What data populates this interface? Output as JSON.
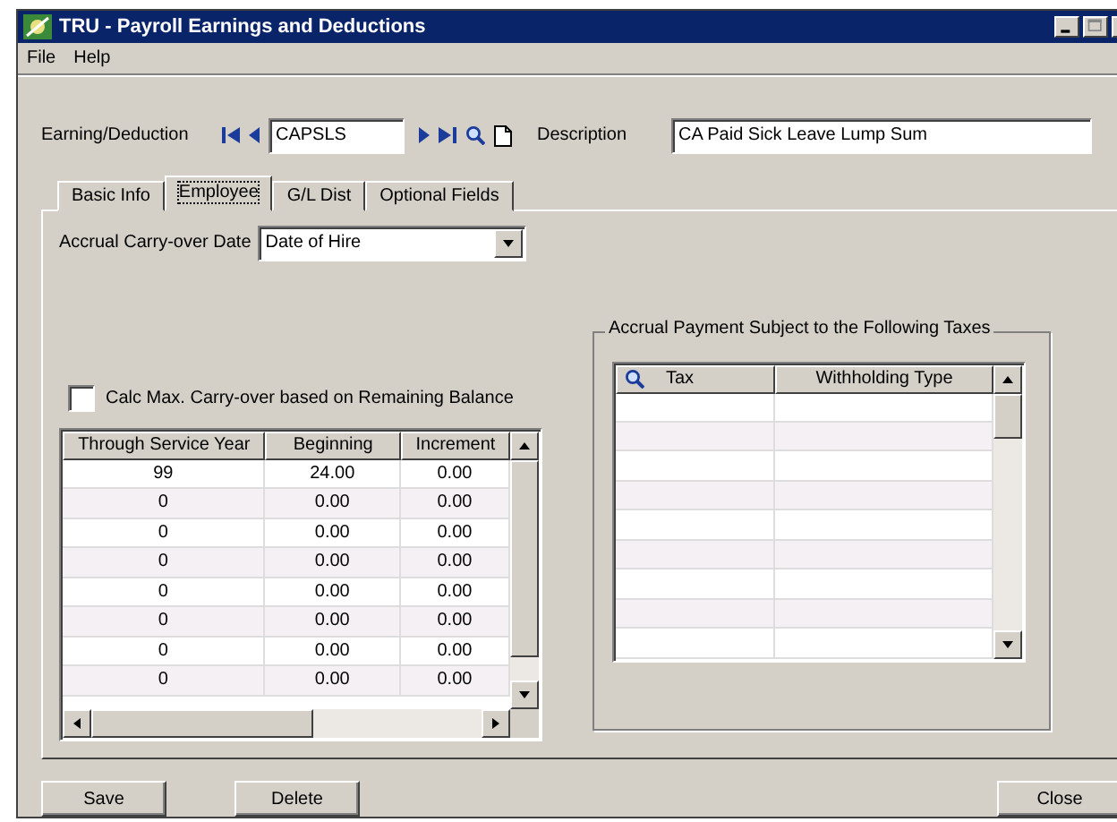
{
  "window": {
    "title": "TRU - Payroll Earnings and Deductions"
  },
  "menu": [
    "File",
    "Help"
  ],
  "header": {
    "code_label": "Earning/Deduction",
    "code_value": "CAPSLS",
    "description_label": "Description",
    "description_value": "CA Paid Sick Leave Lump Sum"
  },
  "tabs": [
    {
      "label": "Basic Info",
      "selected": false
    },
    {
      "label": "Employee",
      "selected": true
    },
    {
      "label": "G/L Dist",
      "selected": false
    },
    {
      "label": "Optional Fields",
      "selected": false
    }
  ],
  "accrual_date": {
    "label": "Accrual Carry-over Date",
    "value": "Date of Hire"
  },
  "calc_max": {
    "label": "Calc Max. Carry-over based on Remaining Balance",
    "checked": false
  },
  "carryover_table": {
    "columns": [
      "Through Service Year",
      "Beginning",
      "Increment"
    ],
    "rows": [
      [
        "99",
        "24.00",
        "0.00"
      ],
      [
        "0",
        "0.00",
        "0.00"
      ],
      [
        "0",
        "0.00",
        "0.00"
      ],
      [
        "0",
        "0.00",
        "0.00"
      ],
      [
        "0",
        "0.00",
        "0.00"
      ],
      [
        "0",
        "0.00",
        "0.00"
      ],
      [
        "0",
        "0.00",
        "0.00"
      ],
      [
        "0",
        "0.00",
        "0.00"
      ]
    ]
  },
  "taxes": {
    "title": "Accrual Payment Subject to the Following Taxes",
    "columns": [
      "Tax",
      "Withholding Type"
    ]
  },
  "buttons": [
    "Save",
    "Delete",
    "Close"
  ]
}
